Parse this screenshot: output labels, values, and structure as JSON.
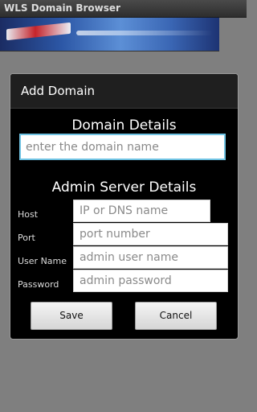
{
  "app": {
    "title": "WLS Domain Browser"
  },
  "dialog": {
    "title": "Add Domain",
    "domain_section_title": "Domain Details",
    "domain_input_placeholder": "enter the domain name",
    "admin_section_title": "Admin Server Details",
    "fields": {
      "host": {
        "label": "Host",
        "placeholder": "IP or DNS name"
      },
      "port": {
        "label": "Port",
        "placeholder": "port number"
      },
      "user_name": {
        "label": "User Name",
        "placeholder": "admin user name"
      },
      "password": {
        "label": "Password",
        "placeholder": "admin password"
      }
    },
    "save_label": "Save",
    "cancel_label": "Cancel"
  },
  "colors": {
    "dialog_background": "#000000",
    "input_focus_border": "#6fc3e3",
    "screen_background": "#7f7f7f"
  }
}
